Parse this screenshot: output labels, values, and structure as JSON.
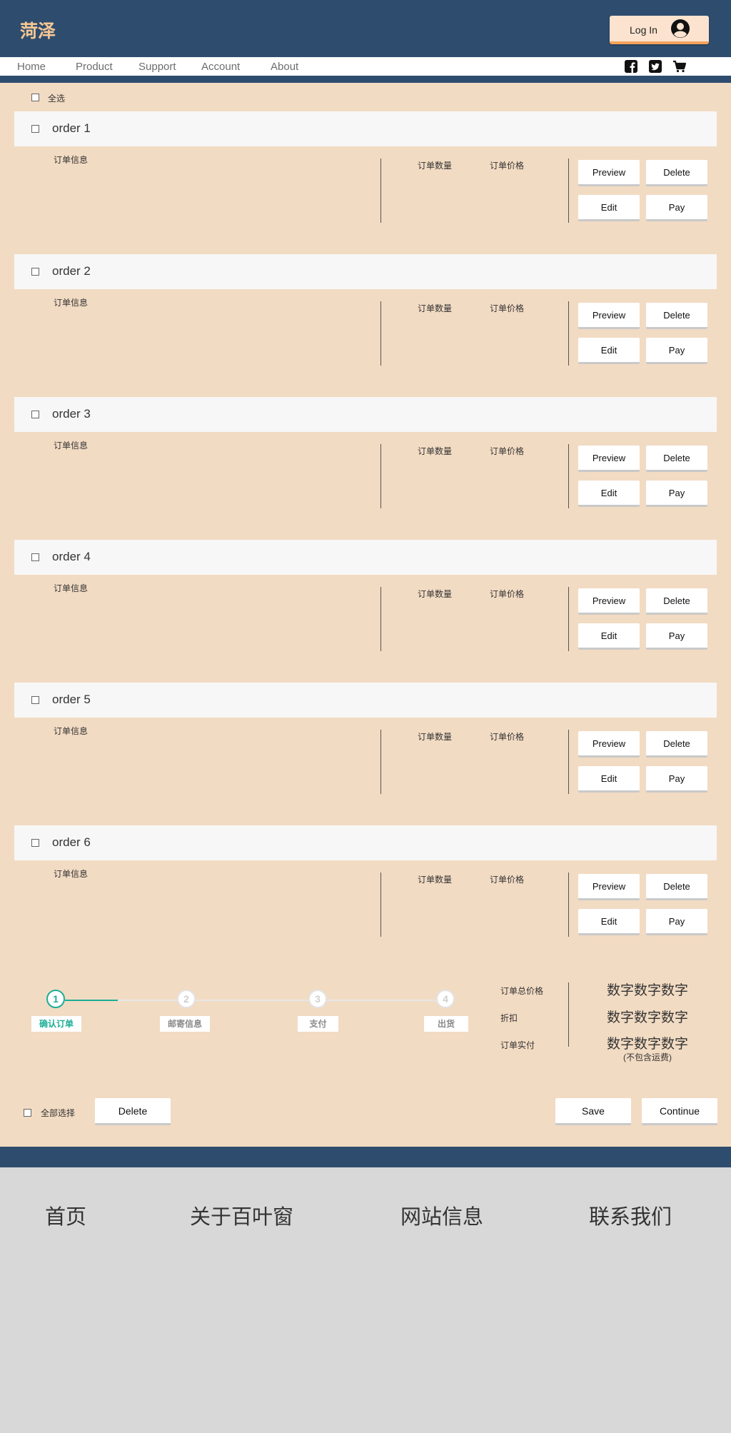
{
  "header": {
    "brand": "菏泽",
    "login_label": "Log In",
    "avatar_icon": "user-circle-icon"
  },
  "nav": {
    "items": [
      "Home",
      "Product",
      "Support",
      "Account",
      "About"
    ],
    "social_icons": [
      "facebook-icon",
      "twitter-icon",
      "cart-icon"
    ]
  },
  "select_all_top": "全选",
  "orders": [
    {
      "title": "order 1",
      "info": "订单信息",
      "qty_label": "订单数量",
      "price_label": "订单价格",
      "buttons": [
        "Preview",
        "Delete",
        "Edit",
        "Pay"
      ]
    },
    {
      "title": "order 2",
      "info": "订单信息",
      "qty_label": "订单数量",
      "price_label": "订单价格",
      "buttons": [
        "Preview",
        "Delete",
        "Edit",
        "Pay"
      ]
    },
    {
      "title": "order 3",
      "info": "订单信息",
      "qty_label": "订单数量",
      "price_label": "订单价格",
      "buttons": [
        "Preview",
        "Delete",
        "Edit",
        "Pay"
      ]
    },
    {
      "title": "order 4",
      "info": "订单信息",
      "qty_label": "订单数量",
      "price_label": "订单价格",
      "buttons": [
        "Preview",
        "Delete",
        "Edit",
        "Pay"
      ]
    },
    {
      "title": "order 5",
      "info": "订单信息",
      "qty_label": "订单数量",
      "price_label": "订单价格",
      "buttons": [
        "Preview",
        "Delete",
        "Edit",
        "Pay"
      ]
    },
    {
      "title": "order 6",
      "info": "订单信息",
      "qty_label": "订单数量",
      "price_label": "订单价格",
      "buttons": [
        "Preview",
        "Delete",
        "Edit",
        "Pay"
      ]
    }
  ],
  "steps": [
    {
      "num": "1",
      "label": "确认订单",
      "active": true
    },
    {
      "num": "2",
      "label": "邮寄信息",
      "active": false
    },
    {
      "num": "3",
      "label": "支付",
      "active": false
    },
    {
      "num": "4",
      "label": "出货",
      "active": false
    }
  ],
  "summary": {
    "total_label": "订单总价格",
    "total_value": "数字数字数字",
    "discount_label": "折扣",
    "discount_value": "数字数字数字",
    "paid_label": "订单实付",
    "paid_value": "数字数字数字",
    "note": "(不包含运费)"
  },
  "bottom_bar": {
    "select_all_label": "全部选择",
    "delete_label": "Delete",
    "save_label": "Save",
    "continue_label": "Continue"
  },
  "footer": {
    "items": [
      "首页",
      "关于百叶窗",
      "网站信息",
      "联系我们"
    ]
  },
  "colors": {
    "header_bg": "#2e4d6e",
    "brand_color": "#f6c794",
    "main_bg": "#f2dbc3",
    "step_active": "#1cae96",
    "footer_bg": "#d8d8d8"
  }
}
